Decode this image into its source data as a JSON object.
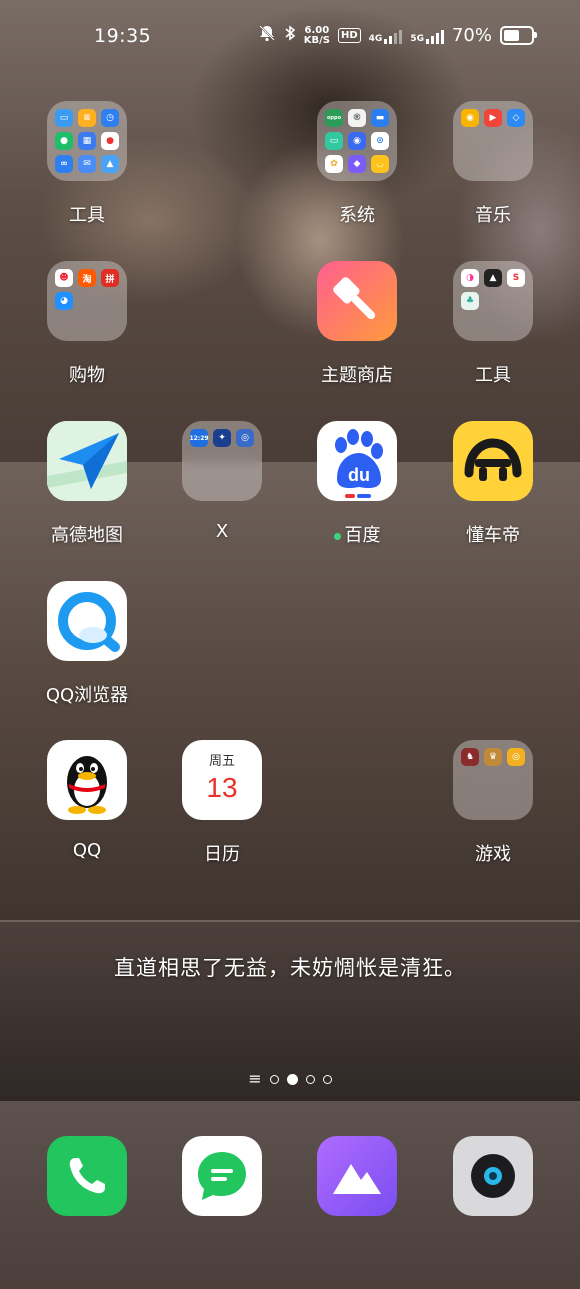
{
  "status_bar": {
    "time": "19:35",
    "net_speed_value": "6.00",
    "net_speed_unit": "KB/S",
    "hd_label": "HD",
    "sim1_label": "4G",
    "sim2_label": "5G",
    "battery_percent": "70%",
    "battery_level": 0.7
  },
  "apps": [
    {
      "label": "工具",
      "type": "folder"
    },
    {
      "label": "系统",
      "type": "folder"
    },
    {
      "label": "音乐",
      "type": "folder"
    },
    {
      "label": "购物",
      "type": "folder"
    },
    {
      "label": "主题商店",
      "type": "app"
    },
    {
      "label": "工具",
      "type": "folder"
    },
    {
      "label": "高德地图",
      "type": "app"
    },
    {
      "label": "X",
      "type": "folder"
    },
    {
      "label": "百度",
      "type": "app"
    },
    {
      "label": "懂车帝",
      "type": "app"
    },
    {
      "label": "QQ浏览器",
      "type": "app"
    },
    {
      "label": "QQ",
      "type": "app"
    },
    {
      "label": "日历",
      "type": "app"
    },
    {
      "label": "游戏",
      "type": "folder"
    }
  ],
  "calendar_icon": {
    "weekday": "周五",
    "day": "13"
  },
  "baidu_icon_text": "du",
  "folder_minis": {
    "system_oppo": "oppo",
    "x_folder_time": "12:29"
  },
  "quote": "直道相思了无益，未妨惆怅是清狂。",
  "pager": {
    "pages": 4,
    "active_index": 1
  },
  "dock": [
    "phone-icon",
    "messages-icon",
    "gallery-icon",
    "camera-icon"
  ],
  "colors": {
    "amap_blue": "#1e8cf0",
    "theme_store_gradient": [
      "#ff5f8f",
      "#ff9a3c"
    ],
    "baidu_blue": "#2d5ff3",
    "dongchedi_yellow": "#ffd23a",
    "phone_green": "#22c55e",
    "gallery_purple": "#9b5cf6"
  }
}
